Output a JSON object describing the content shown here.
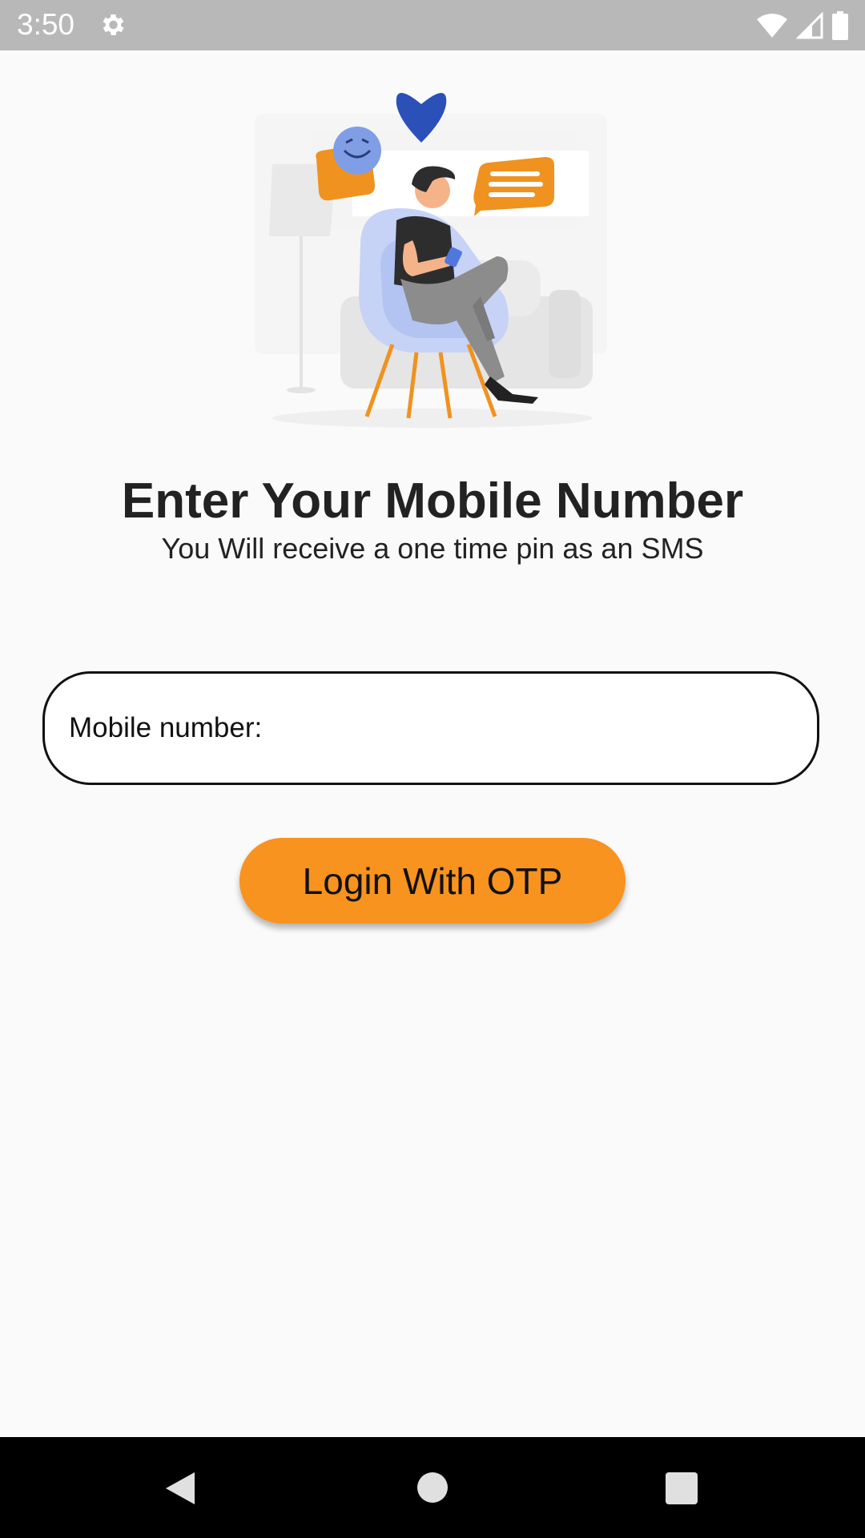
{
  "status_bar": {
    "time": "3:50",
    "icons": [
      "gear-icon",
      "wifi-icon",
      "signal-icon",
      "battery-icon"
    ]
  },
  "illustration": {
    "icon": "person-chatting-illustration"
  },
  "header": {
    "title": "Enter Your Mobile Number",
    "subtitle": "You Will receive a one time pin as an SMS"
  },
  "form": {
    "mobile_label": "Mobile number:",
    "mobile_value": "",
    "login_button_label": "Login With OTP"
  },
  "nav_bar": {
    "icons": [
      "back-icon",
      "home-icon",
      "recents-icon"
    ]
  },
  "colors": {
    "accent": "#f7931e",
    "status_bar": "#b8b8b8",
    "background": "#fafafa",
    "illustration_blue": "#2b50b8",
    "illustration_light_blue": "#c6d3f7"
  }
}
